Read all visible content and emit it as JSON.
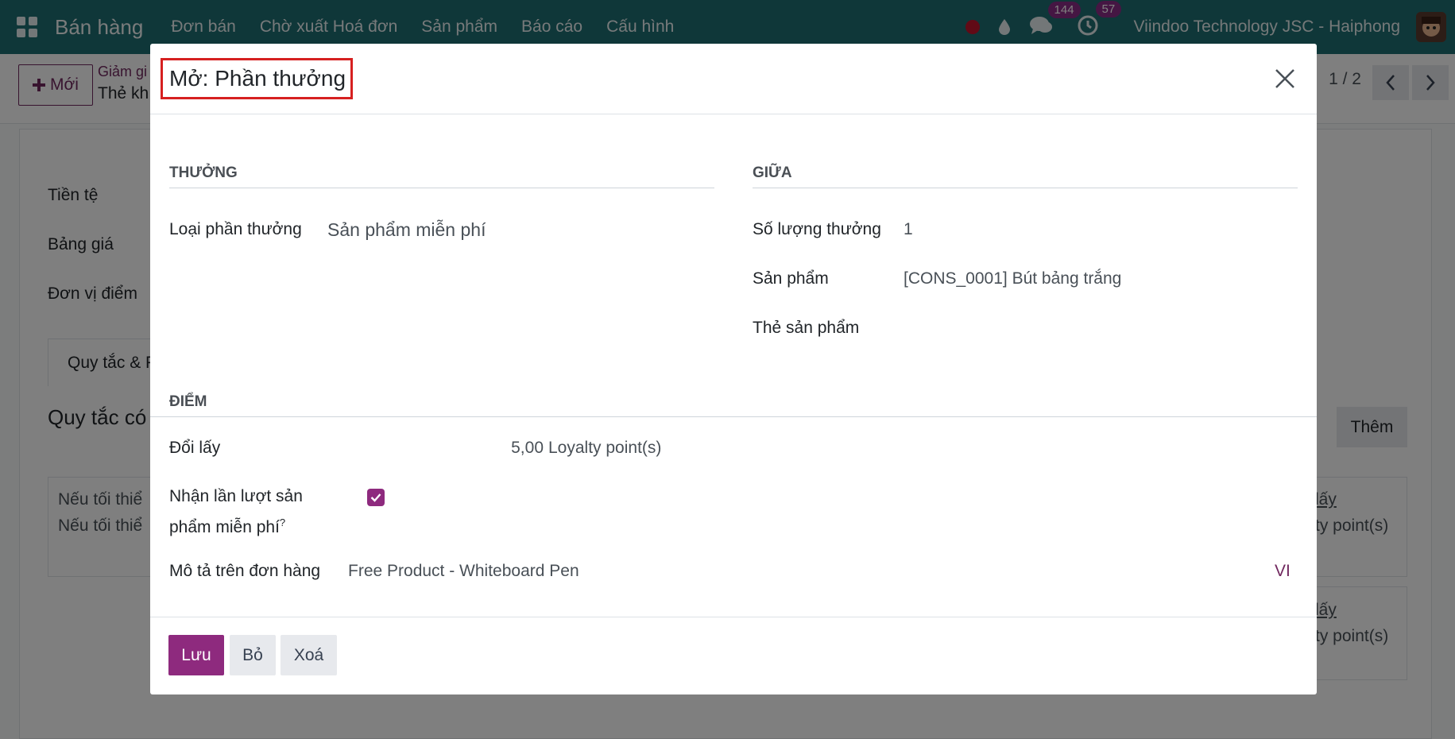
{
  "navbar": {
    "brand": "Bán hàng",
    "menu": [
      "Đơn bán",
      "Chờ xuất Hoá đơn",
      "Sản phẩm",
      "Báo cáo",
      "Cấu hình"
    ],
    "messages_count": "144",
    "activities_count": "57",
    "company": "Viindoo Technology JSC - Haiphong"
  },
  "control": {
    "new_label": "Mới",
    "breadcrumb": "Giảm gi",
    "breadcrumb_current": "Thẻ kh",
    "pager": "1 / 2"
  },
  "background_form": {
    "labels": [
      "Tiền tệ",
      "Bảng giá",
      "Đơn vị điểm"
    ],
    "tab_label": "Quy tắc & P",
    "section_heading": "Quy tắc có",
    "add_button": "Thêm",
    "card_lines": [
      "Nếu tối thiể",
      "Nếu tối thiể"
    ],
    "card_right_1": [
      "lấy",
      "ty point(s)"
    ],
    "card_right_2": [
      "lấy",
      "ty point(s)"
    ]
  },
  "modal": {
    "title": "Mở: Phần thưởng",
    "reward_section": "THƯỞNG",
    "reward_type_label": "Loại phần thưởng",
    "reward_type_value": "Sản phẩm miễn phí",
    "among_section": "GIỮA",
    "reward_qty_label": "Số lượng thưởng",
    "reward_qty_value": "1",
    "product_label": "Sản phẩm",
    "product_value": "[CONS_0001] Bút bảng trắng",
    "product_tag_label": "Thẻ sản phẩm",
    "points_section": "ĐIỂM",
    "redeem_label": "Đổi lấy",
    "redeem_value": "5,00",
    "redeem_unit": "Loyalty point(s)",
    "multi_free_label_1": "Nhận lần lượt sản",
    "multi_free_label_2": "phẩm miễn phí",
    "multi_free_help": "?",
    "multi_free_checked": true,
    "description_label": "Mô tả trên đơn hàng",
    "description_value": "Free Product - Whiteboard Pen",
    "lang_code": "VI"
  },
  "footer": {
    "save": "Lưu",
    "discard": "Bỏ",
    "delete": "Xoá"
  },
  "colors": {
    "navbar": "#1f6e73",
    "primary": "#8e2a7e",
    "highlight_border": "#d62020"
  }
}
